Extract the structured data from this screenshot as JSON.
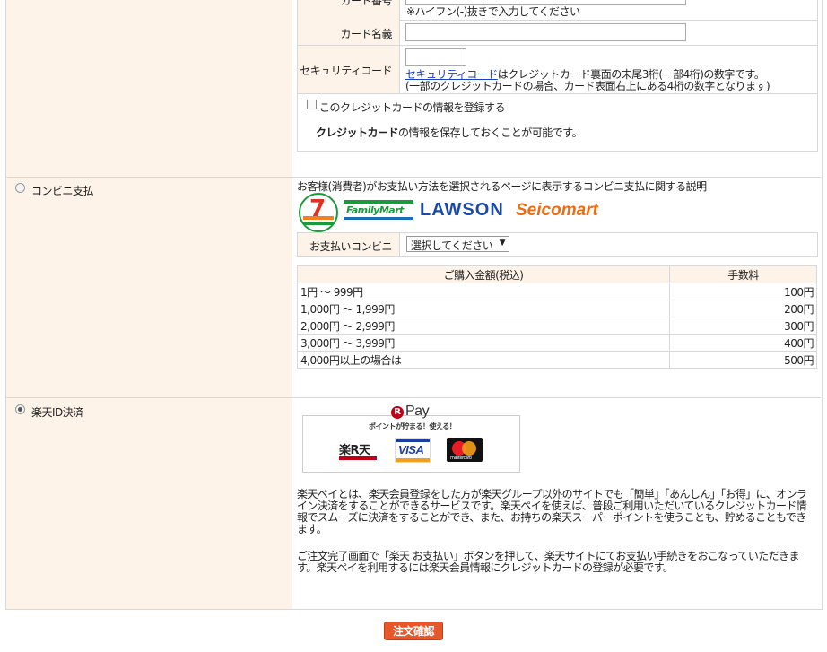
{
  "credit_card": {
    "card_number_label": "カード番号",
    "card_number_note": "※ハイフン(-)抜きで入力してください",
    "card_name_label": "カード名義",
    "security_label": "セキュリティコード",
    "security_link": "セキュリティコード",
    "security_note_1": "はクレジットカード裏面の末尾3桁(一部4桁)の数字です。",
    "security_note_2": "(一部のクレジットカードの場合、カード表面右上にある4桁の数字となります)",
    "save_checkbox_label": "このクレジットカードの情報を登録する",
    "save_note_bold": "クレジットカード",
    "save_note_rest": "の情報を保存しておくことが可能です。"
  },
  "convenience": {
    "radio_label": "コンビニ支払",
    "description": "お客様(消費者)がお支払い方法を選択されるページに表示するコンビニ支払に関する説明",
    "logos": [
      "7-ELEVEN",
      "FamilyMart",
      "LAWSON",
      "Seicomart"
    ],
    "logo_711_text": "7",
    "logo_fm_text": "FamilyMart",
    "logo_lawson_text": "LAWSON",
    "logo_seico_text": "Seicomart",
    "select_label": "お支払いコンビニ",
    "select_value": "選択してください",
    "fee_table": {
      "headers": [
        "ご購入金額(税込)",
        "手数料"
      ],
      "rows": [
        [
          "1円 ～ 999円",
          "100円"
        ],
        [
          "1,000円 ～ 1,999円",
          "200円"
        ],
        [
          "2,000円 ～ 2,999円",
          "300円"
        ],
        [
          "3,000円 ～ 3,999円",
          "400円"
        ],
        [
          "4,000円以上の場合は",
          "500円"
        ]
      ]
    }
  },
  "rakuten": {
    "radio_label": "楽天ID決済",
    "rpay_mark": "R",
    "rpay_text": "Pay",
    "rpay_sub": "ポイントが貯まる！使える！",
    "card_rakuten": "楽R天",
    "card_visa": "VISA",
    "card_mc": "mastercard",
    "paragraph_1": "楽天ペイとは、楽天会員登録をした方が楽天グループ以外のサイトでも「簡単」「あんしん」「お得」に、オンライン決済をすることができるサービスです。楽天ペイを使えば、普段ご利用いただいているクレジットカード情報でスムーズに決済をすることができ、また、お持ちの楽天スーパーポイントを使うことも、貯めることもできます。",
    "paragraph_2": "ご注文完了画面で「楽天 お支払い」ボタンを押して、楽天サイトにてお支払い手続きをおこなっていただきます。楽天ペイを利用するには楽天会員情報にクレジットカードの登録が必要です。"
  },
  "confirm_button": "注文確認"
}
